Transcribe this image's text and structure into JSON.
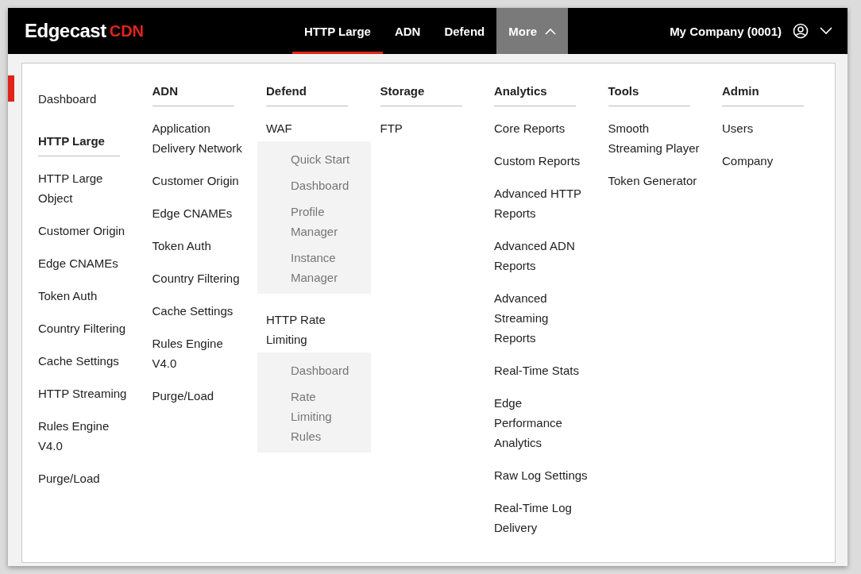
{
  "brand": {
    "name": "Edgecast",
    "suffix": "CDN"
  },
  "tabs": [
    {
      "label": "HTTP Large",
      "selected": true,
      "expanded": false
    },
    {
      "label": "ADN",
      "selected": false,
      "expanded": false
    },
    {
      "label": "Defend",
      "selected": false,
      "expanded": false
    },
    {
      "label": "More",
      "selected": false,
      "expanded": true
    }
  ],
  "account": {
    "label": "My Company (0001)"
  },
  "menu_columns": [
    {
      "items": [
        {
          "kind": "link",
          "label": "Dashboard"
        },
        {
          "kind": "heading",
          "label": "HTTP Large"
        },
        {
          "kind": "link",
          "label": "HTTP Large Object"
        },
        {
          "kind": "link",
          "label": "Customer Origin"
        },
        {
          "kind": "link",
          "label": "Edge CNAMEs"
        },
        {
          "kind": "link",
          "label": "Token Auth"
        },
        {
          "kind": "link",
          "label": "Country Filtering"
        },
        {
          "kind": "link",
          "label": "Cache Settings"
        },
        {
          "kind": "link",
          "label": "HTTP Streaming"
        },
        {
          "kind": "link",
          "label": "Rules Engine V4.0"
        },
        {
          "kind": "link",
          "label": "Purge/Load"
        }
      ]
    },
    {
      "items": [
        {
          "kind": "heading",
          "label": "ADN"
        },
        {
          "kind": "link",
          "label": "Application Delivery Network"
        },
        {
          "kind": "link",
          "label": "Customer Origin"
        },
        {
          "kind": "link",
          "label": "Edge CNAMEs"
        },
        {
          "kind": "link",
          "label": "Token Auth"
        },
        {
          "kind": "link",
          "label": "Country Filtering"
        },
        {
          "kind": "link",
          "label": "Cache Settings"
        },
        {
          "kind": "link",
          "label": "Rules Engine V4.0"
        },
        {
          "kind": "link",
          "label": "Purge/Load"
        }
      ]
    },
    {
      "items": [
        {
          "kind": "heading",
          "label": "Defend"
        },
        {
          "kind": "link",
          "label": "WAF",
          "children": [
            "Quick Start",
            "Dashboard",
            "Profile Manager",
            "Instance Manager"
          ]
        },
        {
          "kind": "link",
          "label": "HTTP Rate Limiting",
          "children": [
            "Dashboard",
            "Rate Limiting Rules"
          ]
        }
      ]
    },
    {
      "items": [
        {
          "kind": "heading",
          "label": "Storage"
        },
        {
          "kind": "link",
          "label": "FTP"
        }
      ]
    },
    {
      "items": [
        {
          "kind": "heading",
          "label": "Analytics"
        },
        {
          "kind": "link",
          "label": "Core Reports"
        },
        {
          "kind": "link",
          "label": "Custom Reports"
        },
        {
          "kind": "link",
          "label": "Advanced HTTP Reports"
        },
        {
          "kind": "link",
          "label": "Advanced ADN Reports"
        },
        {
          "kind": "link",
          "label": "Advanced Streaming Reports"
        },
        {
          "kind": "link",
          "label": "Real-Time Stats"
        },
        {
          "kind": "link",
          "label": "Edge Performance Analytics"
        },
        {
          "kind": "link",
          "label": "Raw Log Settings"
        },
        {
          "kind": "link",
          "label": "Real-Time Log Delivery"
        }
      ]
    },
    {
      "items": [
        {
          "kind": "heading",
          "label": "Tools"
        },
        {
          "kind": "link",
          "label": "Smooth Streaming Player"
        },
        {
          "kind": "link",
          "label": "Token Generator"
        }
      ]
    },
    {
      "items": [
        {
          "kind": "heading",
          "label": "Admin"
        },
        {
          "kind": "link",
          "label": "Users"
        },
        {
          "kind": "link",
          "label": "Company"
        }
      ]
    }
  ]
}
